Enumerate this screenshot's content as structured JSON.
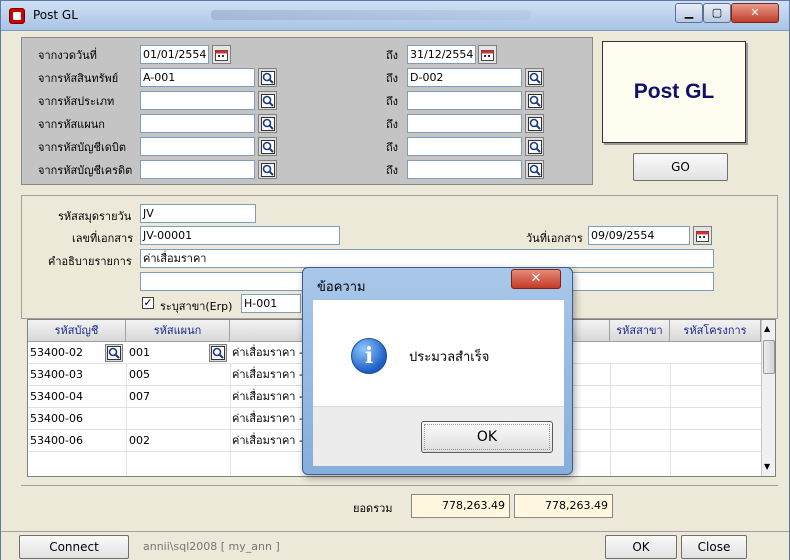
{
  "window": {
    "title": "Post GL"
  },
  "criteria": {
    "rows": [
      {
        "label": "จากงวดวันที่",
        "from": "01/01/2554",
        "to_label": "ถึง",
        "to": "31/12/2554"
      },
      {
        "label": "จากรหัสสินทรัพย์",
        "from": "A-001",
        "to_label": "ถึง",
        "to": "D-002"
      },
      {
        "label": "จากรหัสประเภท",
        "from": "",
        "to_label": "ถึง",
        "to": ""
      },
      {
        "label": "จากรหัสแผนก",
        "from": "",
        "to_label": "ถึง",
        "to": ""
      },
      {
        "label": "จากรหัสบัญชีเดบิต",
        "from": "",
        "to_label": "ถึง",
        "to": ""
      },
      {
        "label": "จากรหัสบัญชีเครดิต",
        "from": "",
        "to_label": "ถึง",
        "to": ""
      }
    ]
  },
  "post_gl": {
    "banner": "Post GL",
    "go_label": "GO"
  },
  "header": {
    "journal_label": "รหัสสมุดรายวัน",
    "journal_value": "JV",
    "docno_label": "เลขที่เอกสาร",
    "docno_value": "JV-00001",
    "docdate_label": "วันที่เอกสาร",
    "docdate_value": "09/09/2554",
    "desc_label": "คำอธิบายรายการ",
    "desc_value": "ค่าเสื่อมราคา",
    "desc2_value": "",
    "branch_label": "ระบุสาขา(Erp)",
    "branch_checked": "✓",
    "branch_value": "H-001"
  },
  "grid": {
    "headers": {
      "account": "รหัสบัญชี",
      "dept": "รหัสแผนก",
      "branch": "รหัสสาขา",
      "project": "รหัสโครงการ"
    },
    "rows": [
      {
        "account": "53400-02",
        "dept": "001",
        "desc": "ค่าเสื่อมราคา -"
      },
      {
        "account": "53400-03",
        "dept": "005",
        "desc": "ค่าเสื่อมราคา -"
      },
      {
        "account": "53400-04",
        "dept": "007",
        "desc": "ค่าเสื่อมราคา -"
      },
      {
        "account": "53400-06",
        "dept": "",
        "desc": "ค่าเสื่อมราคา -"
      },
      {
        "account": "53400-06",
        "dept": "002",
        "desc": "ค่าเสื่อมราคา -"
      }
    ]
  },
  "totals": {
    "label": "ยอดรวม",
    "debit": "778,263.49",
    "credit": "778,263.49"
  },
  "status": {
    "connect": "Connect",
    "connection": "annii\\sql2008 [ my_ann ]",
    "ok": "OK",
    "close": "Close"
  },
  "dialog": {
    "title": "ข้อความ",
    "message": "ประมวลสำเร็จ",
    "ok": "OK",
    "close_glyph": "✕"
  }
}
